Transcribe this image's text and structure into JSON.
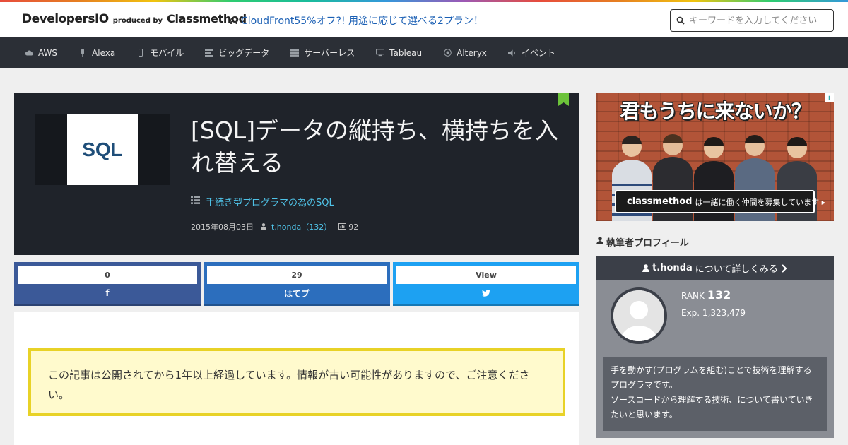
{
  "header": {
    "logo_main": "DevelopersIO",
    "logo_produced": "produced by",
    "logo_company": "Classmethod",
    "promo": "CloudFront55%オフ?! 用途に応じて選べる2プラン！",
    "search_placeholder": "キーワードを入力してください"
  },
  "nav": {
    "items": [
      {
        "label": "AWS",
        "icon": "cloud-icon"
      },
      {
        "label": "Alexa",
        "icon": "microphone-icon"
      },
      {
        "label": "モバイル",
        "icon": "mobile-icon"
      },
      {
        "label": "ビッグデータ",
        "icon": "list-icon"
      },
      {
        "label": "サーバーレス",
        "icon": "server-icon"
      },
      {
        "label": "Tableau",
        "icon": "desktop-icon"
      },
      {
        "label": "Alteryx",
        "icon": "target-icon"
      },
      {
        "label": "イベント",
        "icon": "speaker-icon"
      }
    ]
  },
  "article": {
    "thumb_label": "SQL",
    "title": "[SQL]データの縦持ち、横持ちを入れ替える",
    "category": "手続き型プログラマの為のSQL",
    "date": "2015年08月03日",
    "author": "t.honda（132）",
    "views": "92"
  },
  "shares": {
    "facebook": {
      "count": "0",
      "label": "f"
    },
    "hatena": {
      "count": "29",
      "label": "はてブ"
    },
    "twitter": {
      "count": "View",
      "label": ""
    }
  },
  "notice": "この記事は公開されてから1年以上経過しています。情報が古い可能性がありますので、ご注意ください。",
  "ad": {
    "headline": "君もうちに来ないか？",
    "brand": "classmethod",
    "tagline": "は一緒に働く仲間を募集しています ▸",
    "info": "i"
  },
  "profile": {
    "heading": "執筆者プロフィール",
    "name": "t.honda",
    "more": "について詳しくみる",
    "rank_label": "RANK",
    "rank": "132",
    "exp": "Exp. 1,323,479",
    "bio_line1": "手を動かす(プログラムを組む)ことで技術を理解するプログラマです。",
    "bio_line2": "ソースコードから理解する技術、について書いていきたいと思います。"
  },
  "colors": {
    "nav_bg": "#2b2f36",
    "hero_bg": "#1f232a",
    "link": "#4fc3e8",
    "facebook": "#3b5998",
    "hatena": "#2c6ebd",
    "twitter": "#1da1f2",
    "notice_border": "#e8d227",
    "notice_bg": "#fffacd"
  }
}
